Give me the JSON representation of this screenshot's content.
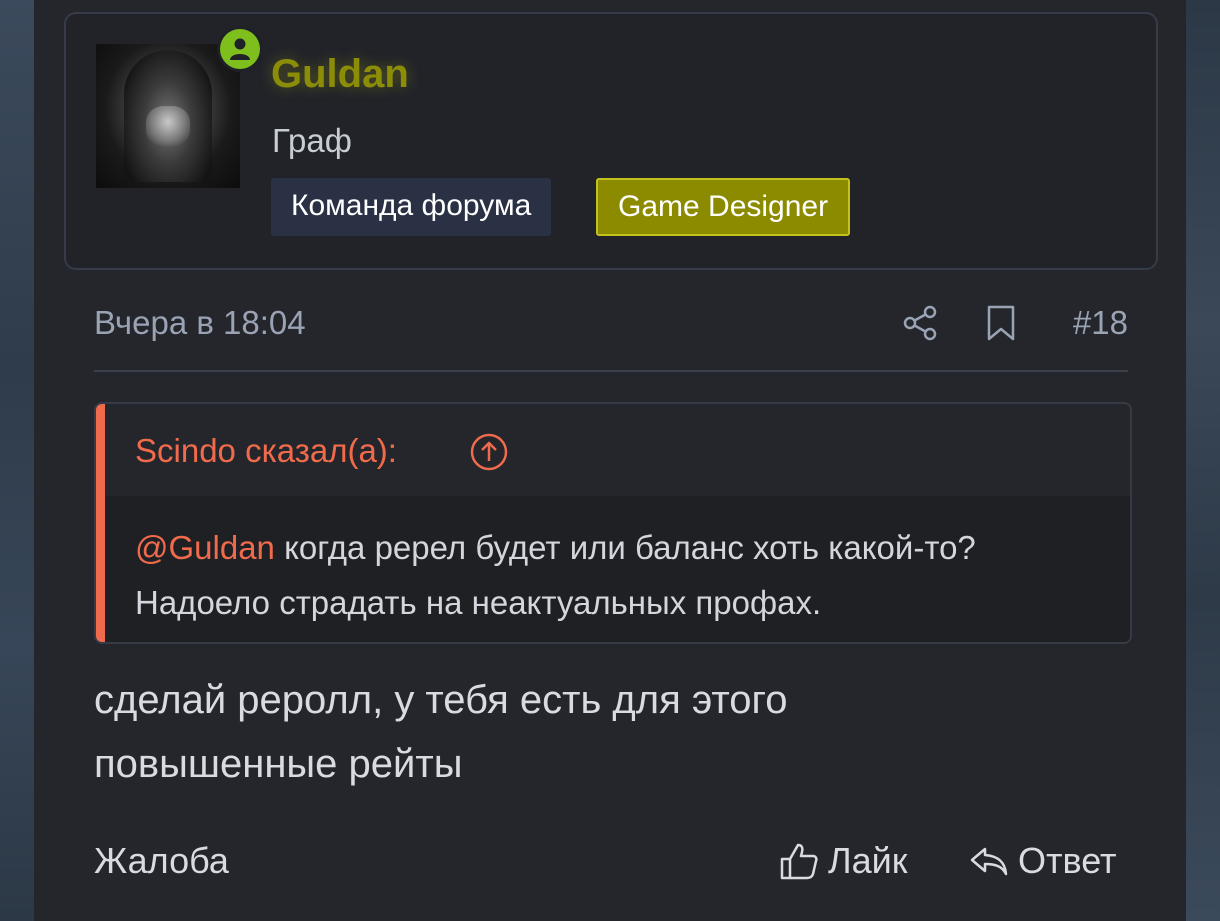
{
  "user": {
    "name": "Guldan",
    "title": "Граф",
    "status": "online",
    "banners": [
      "Команда форума",
      "Game Designer"
    ]
  },
  "post": {
    "date": "Вчера в 18:04",
    "number": "#18",
    "quote": {
      "author": "Scindo сказал(а):",
      "mention": "@Guldan",
      "text": " когда ререл будет или баланс хоть какой-то? Надоело страдать на неактуальных профах."
    },
    "message": "сделай реролл, у тебя есть для этого повышенные рейты",
    "actions": {
      "report": "Жалоба",
      "like": "Лайк",
      "reply": "Ответ"
    }
  },
  "colors": {
    "username": "#8c8d07",
    "designer_banner": "#8c8b00",
    "team_banner": "#2a3144",
    "quote_accent": "#f06a4c",
    "online": "#7fbf1d",
    "background": "#24262b"
  },
  "icons": {
    "online": "user-online-icon",
    "share": "share-icon",
    "bookmark": "bookmark-icon",
    "quote_jump": "arrow-up-circle-icon",
    "like": "thumbs-up-icon",
    "reply": "reply-icon"
  }
}
